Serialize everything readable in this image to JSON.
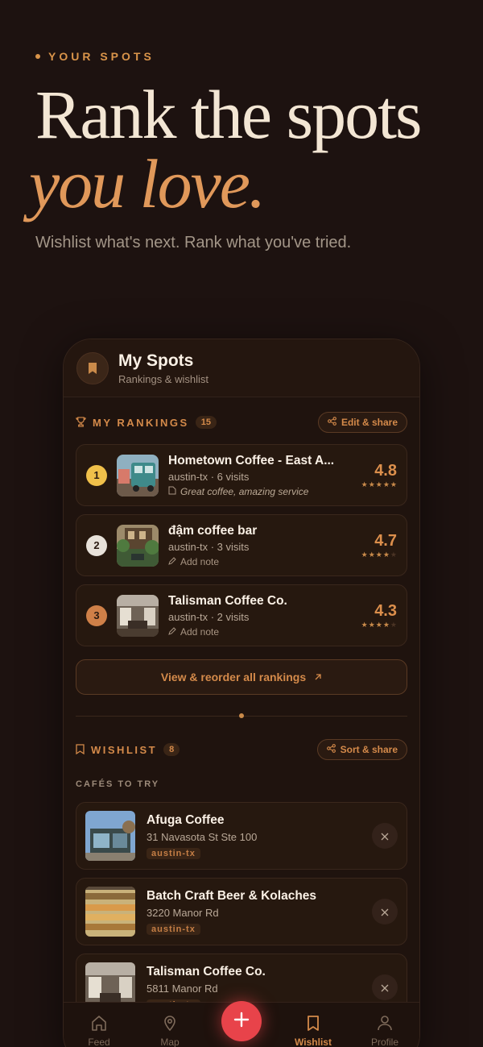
{
  "hero": {
    "eyebrow": "YOUR SPOTS",
    "title_line1": "Rank the spots",
    "title_line2": "you love.",
    "subtitle": "Wishlist what's next. Rank what you've tried."
  },
  "app": {
    "title": "My Spots",
    "subtitle": "Rankings & wishlist"
  },
  "rankings": {
    "title": "MY RANKINGS",
    "count": "15",
    "action_label": "Edit & share",
    "items": [
      {
        "rank": "1",
        "name": "Hometown Coffee - East A...",
        "meta": "austin-tx · 6 visits",
        "note": "Great coffee, amazing service",
        "score": "4.8",
        "stars": 5,
        "badge_color": "#f0c04a"
      },
      {
        "rank": "2",
        "name": "đậm coffee bar",
        "meta": "austin-tx · 3 visits",
        "note": "Add note",
        "score": "4.7",
        "stars": 4,
        "badge_color": "#e8e2da"
      },
      {
        "rank": "3",
        "name": "Talisman Coffee Co.",
        "meta": "austin-tx · 2 visits",
        "note": "Add note",
        "score": "4.3",
        "stars": 4,
        "badge_color": "#cf8048"
      }
    ],
    "view_all_label": "View & reorder all rankings"
  },
  "wishlist": {
    "title": "WISHLIST",
    "count": "8",
    "action_label": "Sort & share",
    "category": "CAFÉS TO TRY",
    "items": [
      {
        "name": "Afuga Coffee",
        "address": "31 Navasota St Ste 100",
        "tag": "austin-tx"
      },
      {
        "name": "Batch Craft Beer & Kolaches",
        "address": "3220 Manor Rd",
        "tag": "austin-tx"
      },
      {
        "name": "Talisman Coffee Co.",
        "address": "5811 Manor Rd",
        "tag": "austin-tx"
      }
    ]
  },
  "tabbar": {
    "feed": "Feed",
    "map": "Map",
    "wishlist": "Wishlist",
    "profile": "Profile",
    "active": "wishlist"
  },
  "colors": {
    "background": "#1d1210",
    "accent": "#d48a4a",
    "fab": "#e8434a"
  }
}
